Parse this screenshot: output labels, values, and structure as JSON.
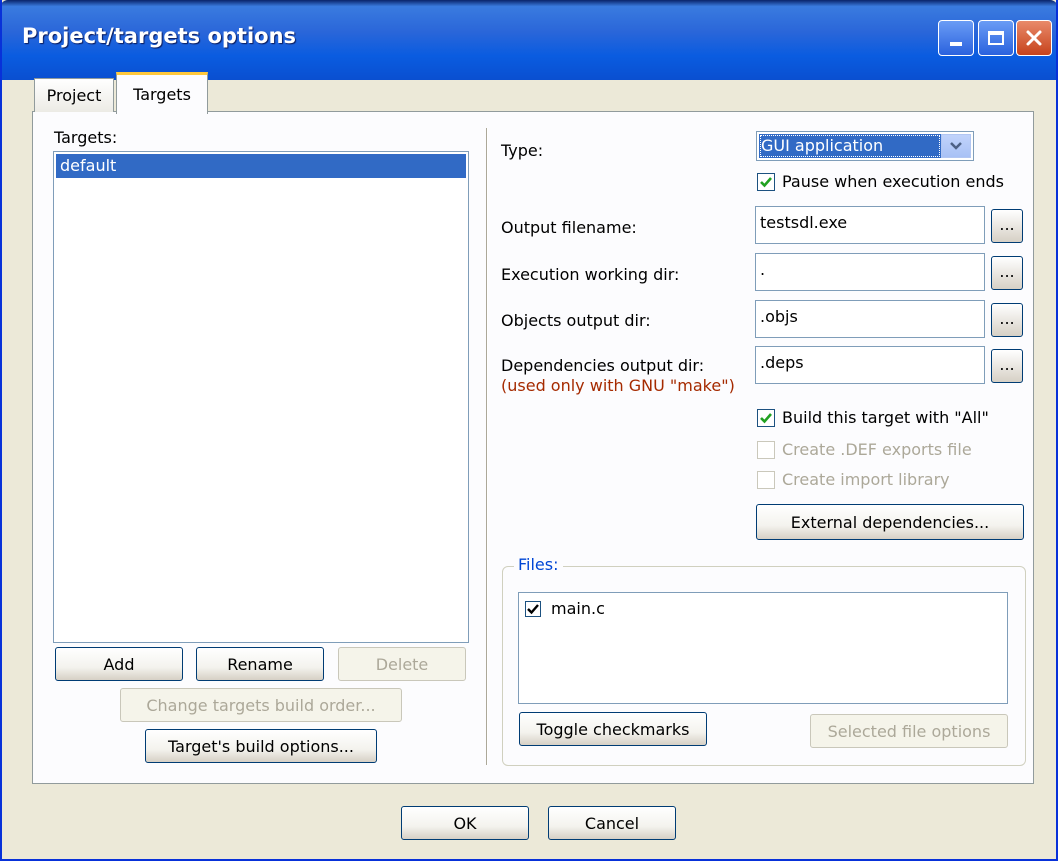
{
  "window": {
    "title": "Project/targets options"
  },
  "tabs": [
    {
      "label": "Project"
    },
    {
      "label": "Targets"
    }
  ],
  "targets": {
    "label": "Targets:",
    "items": [
      "default"
    ],
    "selected": "default",
    "add_label": "Add",
    "rename_label": "Rename",
    "delete_label": "Delete",
    "change_order_label": "Change targets build order...",
    "build_options_label": "Target's build options..."
  },
  "settings": {
    "type_label": "Type:",
    "type_value": "GUI application",
    "pause_label": "Pause when execution ends",
    "pause_checked": true,
    "output_filename_label": "Output filename:",
    "output_filename_value": "testsdl.exe",
    "exec_dir_label": "Execution working dir:",
    "exec_dir_value": ".",
    "objects_dir_label": "Objects output dir:",
    "objects_dir_value": ".objs",
    "deps_dir_label": "Dependencies output dir:",
    "deps_dir_note": "(used only with GNU \"make\")",
    "deps_dir_value": ".deps",
    "browse_label": "...",
    "build_all_label": "Build this target with \"All\"",
    "build_all_checked": true,
    "def_exports_label": "Create .DEF exports file",
    "def_exports_checked": false,
    "import_lib_label": "Create import library",
    "import_lib_checked": false,
    "external_deps_label": "External dependencies..."
  },
  "files": {
    "group_label": "Files:",
    "items": [
      {
        "name": "main.c",
        "checked": true
      }
    ],
    "toggle_label": "Toggle checkmarks",
    "selected_options_label": "Selected file options"
  },
  "footer": {
    "ok_label": "OK",
    "cancel_label": "Cancel"
  },
  "colors": {
    "selection": "#316ac5",
    "note_text": "#a52a00",
    "group_title": "#0046d5"
  }
}
